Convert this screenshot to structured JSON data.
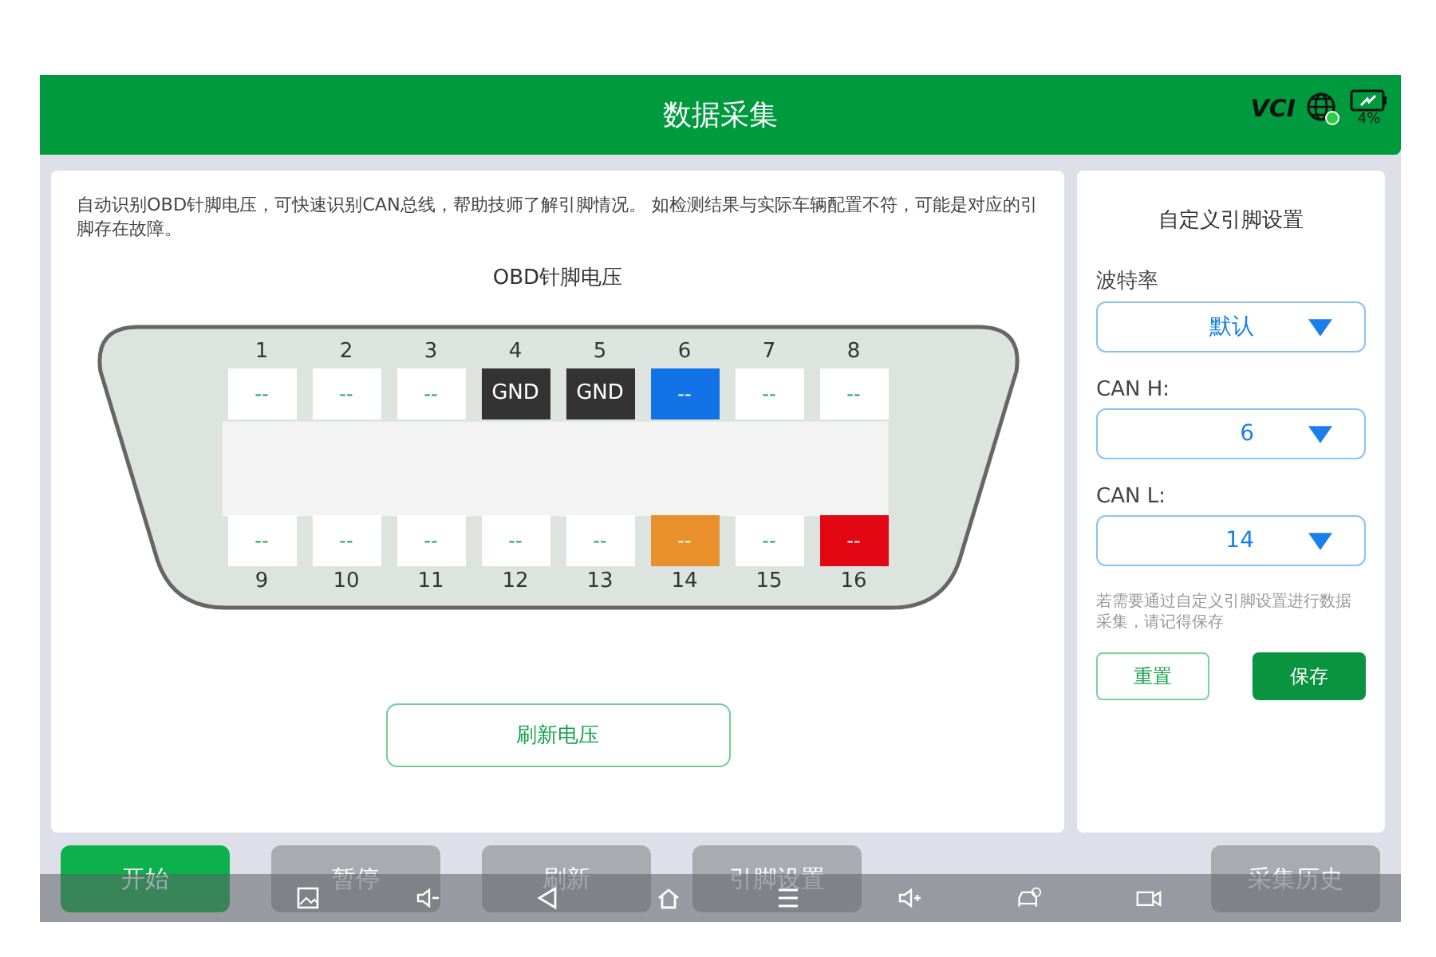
{
  "header": {
    "title": "数据采集",
    "vci": "VCI",
    "battery": "4%"
  },
  "intro": "自动识别OBD针脚电压，可快速识别CAN总线，帮助技师了解引脚情况。 如检测结果与实际车辆配置不符，可能是对应的引脚存在故障。",
  "connector": {
    "title": "OBD针脚电压",
    "top_pins": [
      {
        "number": "1",
        "value": "--",
        "kind": "idle"
      },
      {
        "number": "2",
        "value": "--",
        "kind": "idle"
      },
      {
        "number": "3",
        "value": "--",
        "kind": "idle"
      },
      {
        "number": "4",
        "value": "GND",
        "kind": "ground"
      },
      {
        "number": "5",
        "value": "GND",
        "kind": "ground"
      },
      {
        "number": "6",
        "value": "--",
        "kind": "marked",
        "color": "#1273e6"
      },
      {
        "number": "7",
        "value": "--",
        "kind": "idle"
      },
      {
        "number": "8",
        "value": "--",
        "kind": "idle"
      }
    ],
    "bottom_pins": [
      {
        "number": "9",
        "value": "--",
        "kind": "idle"
      },
      {
        "number": "10",
        "value": "--",
        "kind": "idle"
      },
      {
        "number": "11",
        "value": "--",
        "kind": "idle"
      },
      {
        "number": "12",
        "value": "--",
        "kind": "idle"
      },
      {
        "number": "13",
        "value": "--",
        "kind": "idle"
      },
      {
        "number": "14",
        "value": "--",
        "kind": "marked",
        "color": "#e8912c"
      },
      {
        "number": "15",
        "value": "--",
        "kind": "idle"
      },
      {
        "number": "16",
        "value": "--",
        "kind": "marked",
        "color": "#e30613"
      }
    ],
    "refresh_button": "刷新电压"
  },
  "settings": {
    "title": "自定义引脚设置",
    "fields": [
      {
        "label": "波特率",
        "value": "默认"
      },
      {
        "label": "CAN H:",
        "value": "6"
      },
      {
        "label": "CAN L:",
        "value": "14"
      }
    ],
    "note": "若需要通过自定义引脚设置进行数据采集，请记得保存",
    "buttons": [
      {
        "label": "重置",
        "kind": "outline"
      },
      {
        "label": "保存",
        "kind": "solid"
      }
    ]
  },
  "actions": [
    {
      "label": "开始",
      "kind": "primary"
    },
    {
      "label": "暂停",
      "kind": "muted"
    },
    {
      "label": "刷新",
      "kind": "muted"
    },
    {
      "label": "引脚设置",
      "kind": "muted"
    },
    {
      "label": "采集历史",
      "kind": "muted"
    }
  ]
}
